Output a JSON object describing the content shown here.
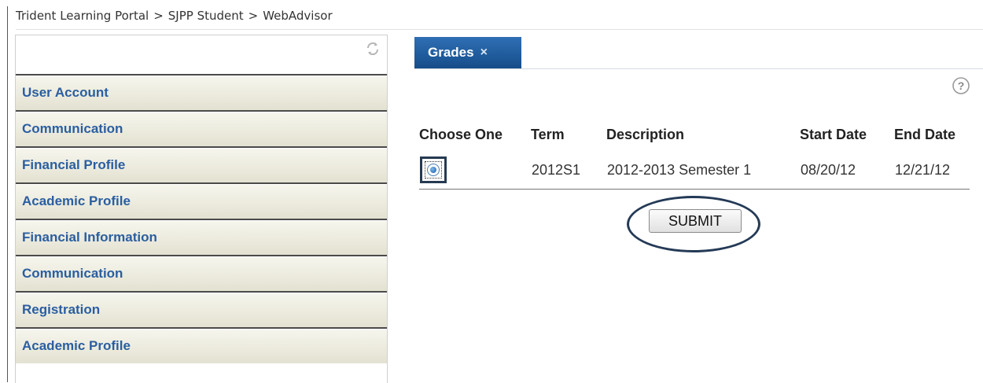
{
  "breadcrumb": {
    "items": [
      "Trident Learning Portal",
      "SJPP Student",
      "WebAdvisor"
    ],
    "separator": ">"
  },
  "sidebar": {
    "refresh_icon": "refresh-icon",
    "items": [
      {
        "label": "User Account"
      },
      {
        "label": "Communication"
      },
      {
        "label": "Financial Profile"
      },
      {
        "label": "Academic Profile"
      },
      {
        "label": "Financial Information"
      },
      {
        "label": "Communication"
      },
      {
        "label": "Registration"
      },
      {
        "label": "Academic Profile"
      }
    ],
    "item_text_color": "#2b5ea0"
  },
  "tab": {
    "label": "Grades",
    "close_label": "×",
    "color": "#1f5b9c"
  },
  "help": {
    "label": "?"
  },
  "table": {
    "columns": [
      "Choose One",
      "Term",
      "Description",
      "Start Date",
      "End Date"
    ],
    "rows": [
      {
        "selected": true,
        "term": "2012S1",
        "description": "2012-2013 Semester 1",
        "start_date": "08/20/12",
        "end_date": "12/21/12"
      }
    ]
  },
  "submit": {
    "label": "SUBMIT"
  }
}
